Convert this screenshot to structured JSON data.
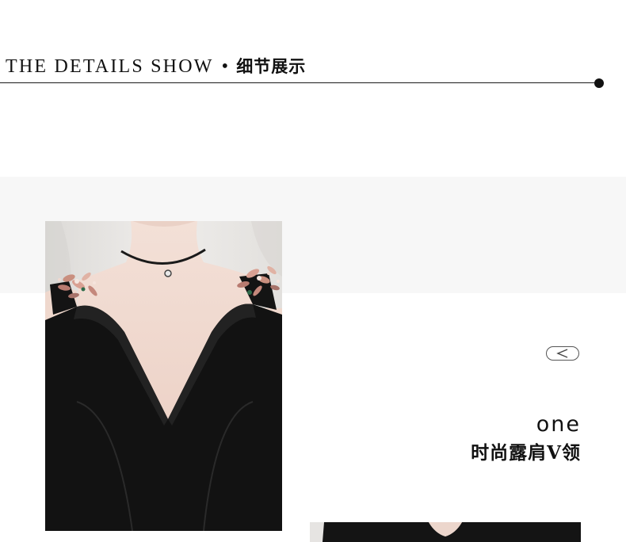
{
  "header": {
    "title_en": "THE DETAILS SHOW",
    "bullet": "•",
    "title_cn": "细节展示"
  },
  "detail": {
    "prev_icon": "chevron-left-icon",
    "caption_en": "one",
    "caption_cn": "时尚露肩V领"
  },
  "colors": {
    "text": "#111111",
    "band": "#f7f7f7",
    "dress": "#121212",
    "skin": "#f1dcd3"
  }
}
